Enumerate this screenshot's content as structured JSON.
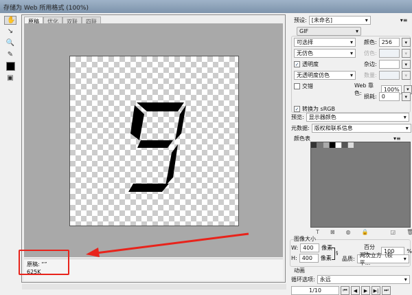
{
  "window": {
    "title": "存储为 Web 所用格式 (100%)"
  },
  "tools": [
    "hand-tool",
    "slice-select-tool",
    "zoom-tool",
    "eyedropper-tool",
    "eyedropper-color",
    "toggle-slices"
  ],
  "tabs": [
    {
      "label": "原稿",
      "active": true
    },
    {
      "label": "优化"
    },
    {
      "label": "双联"
    },
    {
      "label": "四联"
    }
  ],
  "info": {
    "name": "原稿: “”",
    "size": "625K"
  },
  "settings": {
    "preset_label": "预设:",
    "preset_value": "[未命名]",
    "format": "GIF",
    "reduction": "可选择",
    "dither": "无仿色",
    "transparency_label": "透明度",
    "transparency_checked": true,
    "trans_dither": "无透明度仿色",
    "interlaced_label": "交错",
    "interlaced_checked": false,
    "colors_label": "颜色:",
    "colors_value": "256",
    "dither_label": "仿色:",
    "matte_label": "杂边:",
    "amount_label": "数量:",
    "websnap_label": "Web 靠色:",
    "websnap_value": "100%",
    "lossy_label": "损耗:",
    "lossy_value": "0",
    "srgb_label": "转换为 sRGB",
    "srgb_checked": true,
    "preview_label": "预览:",
    "preview_value": "显示器颜色",
    "metadata_label": "元数据:",
    "metadata_value": "版权和联系信息"
  },
  "color_table": {
    "title": "颜色表",
    "swatches": [
      "#333333",
      "#777777",
      "#aaaaaa",
      "#000000",
      "#ffffff",
      "#555555",
      "#dddddd"
    ]
  },
  "image_size": {
    "title": "图像大小",
    "w_label": "W:",
    "w_value": "400",
    "h_label": "H:",
    "h_value": "400",
    "unit": "像素",
    "percent_label": "百分比:",
    "percent_value": "100",
    "percent_unit": "%",
    "quality_label": "品质:",
    "quality_value": "两次立方（较平..."
  },
  "animation": {
    "title": "动画",
    "loop_label": "循环选项:",
    "loop_value": "永远",
    "frame": "1/10"
  }
}
